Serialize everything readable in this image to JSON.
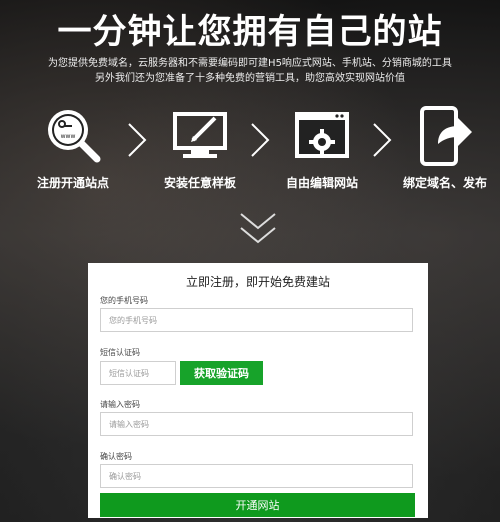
{
  "hero": {
    "title": "一分钟让您拥有自己的站",
    "desc_line1": "为您提供免费域名，云服务器和不需要编码即可建H5响应式网站、手机站、分销商城的工具",
    "desc_line2": "另外我们还为您准备了十多种免费的营销工具，助您高效实现网站价值"
  },
  "steps": [
    {
      "label": "注册开通站点",
      "icon": "magnifier-www-icon"
    },
    {
      "label": "安装任意样板",
      "icon": "monitor-pen-icon"
    },
    {
      "label": "自由编辑网站",
      "icon": "browser-gear-icon"
    },
    {
      "label": "绑定域名、发布",
      "icon": "phone-share-icon"
    }
  ],
  "form": {
    "title": "立即注册，即开始免费建站",
    "phone_label": "您的手机号码",
    "phone_placeholder": "您的手机号码",
    "sms_label": "短信认证码",
    "sms_placeholder": "短信认证码",
    "get_code_label": "获取验证码",
    "password_label": "请输入密码",
    "password_placeholder": "请输入密码",
    "confirm_label": "确认密码",
    "confirm_placeholder": "确认密码",
    "submit_label": "开通网站"
  },
  "colors": {
    "accent_green": "#17a32a",
    "submit_green": "#0f9a1e"
  }
}
